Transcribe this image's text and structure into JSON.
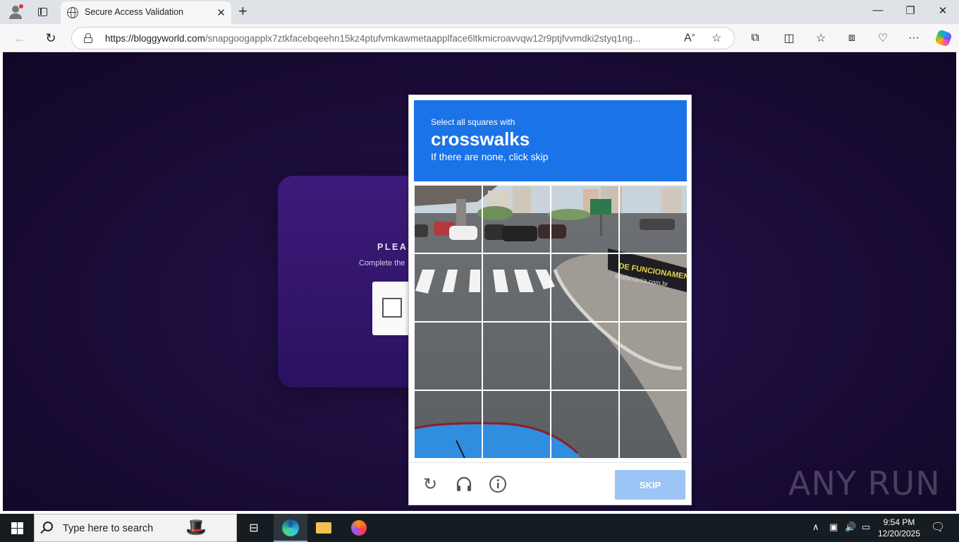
{
  "browser": {
    "tab_title": "Secure Access Validation",
    "url_host": "https://bloggyworld.com",
    "url_path": "/snapgoogapplx7ztkfacebqeehn15kz4ptufvmkawmetaapplface6ltkmicroavvqw12r9ptjfvvmdki2styq1ng..."
  },
  "page": {
    "heading": "PLEAS",
    "subtext": "Complete the"
  },
  "captcha": {
    "line1": "Select all squares with",
    "target": "crosswalks",
    "line3": "If there are none, click skip",
    "skip_label": "SKIP",
    "grid_rows": 4,
    "grid_cols": 4
  },
  "watermark": "ANY RUN",
  "taskbar": {
    "search_placeholder": "Type here to search",
    "time": "9:54 PM",
    "date": "12/20/2025"
  },
  "colors": {
    "captcha_header": "#1b73e8",
    "skip_button": "#9cc4f4",
    "page_bg": "#1c0d3c"
  }
}
